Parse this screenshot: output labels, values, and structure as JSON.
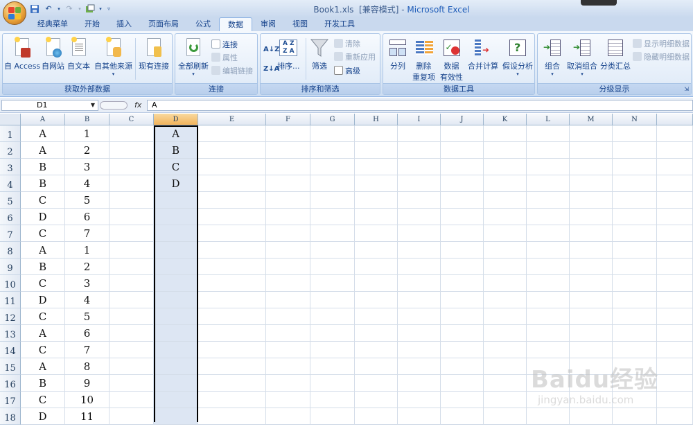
{
  "window": {
    "title_file": "Book1.xls",
    "title_mode": "[兼容模式]",
    "title_sep": "-",
    "title_app": "Microsoft Excel"
  },
  "tabs": [
    "经典菜单",
    "开始",
    "插入",
    "页面布局",
    "公式",
    "数据",
    "审阅",
    "视图",
    "开发工具"
  ],
  "active_tab": "数据",
  "ribbon": {
    "external_data": {
      "label": "获取外部数据",
      "buttons": [
        "自 Access",
        "自网站",
        "自文本",
        "自其他来源",
        "现有连接"
      ]
    },
    "connections": {
      "label": "连接",
      "refresh_all": "全部刷新",
      "connections": "连接",
      "properties": "属性",
      "edit_links": "编辑链接"
    },
    "sort_filter": {
      "label": "排序和筛选",
      "sort": "排序...",
      "filter": "筛选",
      "clear": "清除",
      "reapply": "重新应用",
      "advanced": "高级"
    },
    "data_tools": {
      "label": "数据工具",
      "text_to_columns": "分列",
      "remove_dup_1": "删除",
      "remove_dup_2": "重复项",
      "validation_1": "数据",
      "validation_2": "有效性",
      "consolidate": "合并计算",
      "what_if": "假设分析"
    },
    "outline": {
      "label": "分级显示",
      "group": "组合",
      "ungroup": "取消组合",
      "subtotal": "分类汇总",
      "show_detail": "显示明细数据",
      "hide_detail": "隐藏明细数据"
    }
  },
  "formula_bar": {
    "name_box": "D1",
    "fx": "fx",
    "content": "A"
  },
  "columns": [
    "A",
    "B",
    "C",
    "D",
    "E",
    "F",
    "G",
    "H",
    "I",
    "J",
    "K",
    "L",
    "M",
    "N"
  ],
  "selected_column": "D",
  "rows": [
    {
      "n": "1",
      "A": "A",
      "B": "1",
      "D": "A"
    },
    {
      "n": "2",
      "A": "A",
      "B": "2",
      "D": "B"
    },
    {
      "n": "3",
      "A": "B",
      "B": "3",
      "D": "C"
    },
    {
      "n": "4",
      "A": "B",
      "B": "4",
      "D": "D"
    },
    {
      "n": "5",
      "A": "C",
      "B": "5",
      "D": ""
    },
    {
      "n": "6",
      "A": "D",
      "B": "6",
      "D": ""
    },
    {
      "n": "7",
      "A": "C",
      "B": "7",
      "D": ""
    },
    {
      "n": "8",
      "A": "A",
      "B": "1",
      "D": ""
    },
    {
      "n": "9",
      "A": "B",
      "B": "2",
      "D": ""
    },
    {
      "n": "10",
      "A": "C",
      "B": "3",
      "D": ""
    },
    {
      "n": "11",
      "A": "D",
      "B": "4",
      "D": ""
    },
    {
      "n": "12",
      "A": "C",
      "B": "5",
      "D": ""
    },
    {
      "n": "13",
      "A": "A",
      "B": "6",
      "D": ""
    },
    {
      "n": "14",
      "A": "C",
      "B": "7",
      "D": ""
    },
    {
      "n": "15",
      "A": "A",
      "B": "8",
      "D": ""
    },
    {
      "n": "16",
      "A": "B",
      "B": "9",
      "D": ""
    },
    {
      "n": "17",
      "A": "C",
      "B": "10",
      "D": ""
    },
    {
      "n": "18",
      "A": "D",
      "B": "11",
      "D": ""
    }
  ],
  "watermark": {
    "main": "Baidu经验",
    "url": "jingyan.baidu.com"
  }
}
